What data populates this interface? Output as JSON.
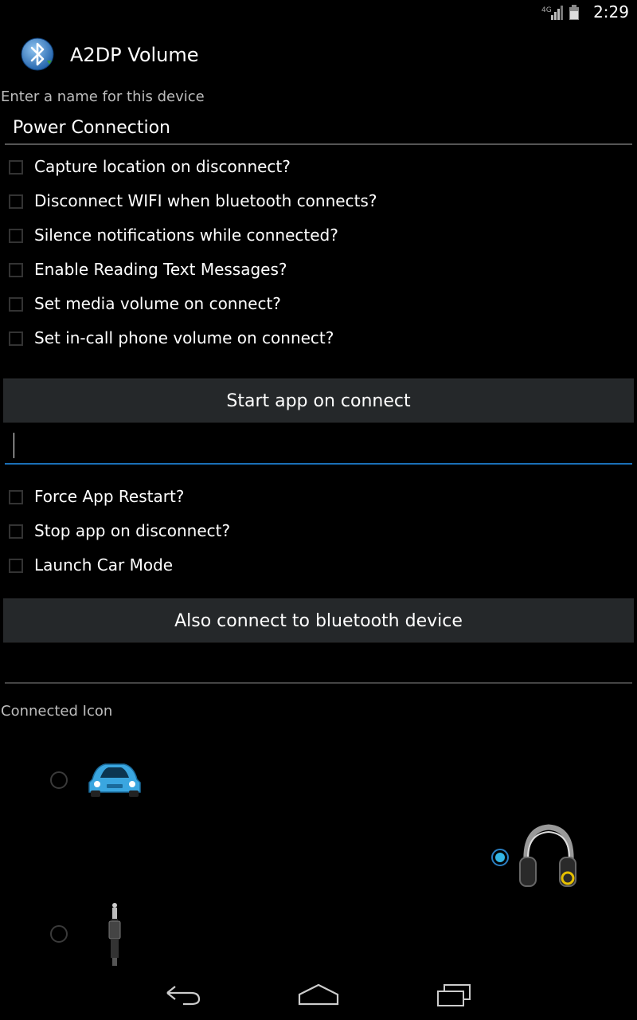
{
  "status_bar": {
    "network": "4G",
    "time": "2:29"
  },
  "header": {
    "icon": "bluetooth-icon",
    "title": "A2DP Volume"
  },
  "name_field": {
    "hint": "Enter a name for this device",
    "value": "Power Connection"
  },
  "checkboxes_top": [
    {
      "label": "Capture location on disconnect?",
      "checked": false
    },
    {
      "label": "Disconnect WIFI when bluetooth connects?",
      "checked": false
    },
    {
      "label": "Silence notifications while connected?",
      "checked": false
    },
    {
      "label": "Enable Reading Text Messages?",
      "checked": false
    },
    {
      "label": "Set media volume on connect?",
      "checked": false
    },
    {
      "label": "Set in-call phone volume on connect?",
      "checked": false
    }
  ],
  "start_app_button": {
    "label": "Start app on connect"
  },
  "start_app_field": {
    "value": ""
  },
  "checkboxes_bottom": [
    {
      "label": "Force App Restart?",
      "checked": false
    },
    {
      "label": "Stop app on disconnect?",
      "checked": false
    },
    {
      "label": "Launch Car Mode",
      "checked": false
    }
  ],
  "bt_connect_button": {
    "label": "Also connect to bluetooth device"
  },
  "bt_connect_field": {
    "value": ""
  },
  "connected_icon": {
    "label": "Connected Icon",
    "options": [
      {
        "icon": "car-icon",
        "selected": false
      },
      {
        "icon": "headphones-icon",
        "selected": true
      },
      {
        "icon": "audio-jack-icon",
        "selected": false
      }
    ]
  },
  "colors": {
    "accent": "#33b5e5",
    "button_bg": "#25282a",
    "background": "#000000"
  }
}
